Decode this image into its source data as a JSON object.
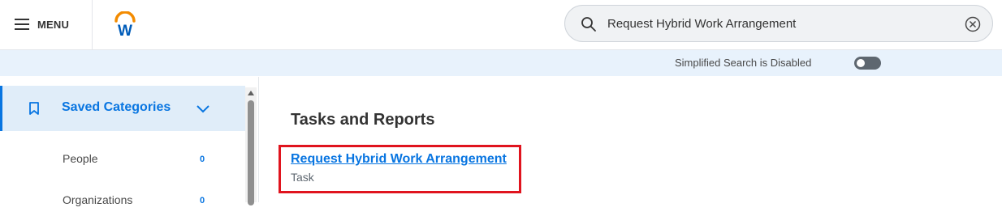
{
  "header": {
    "menu_label": "MENU",
    "logo_letter": "W",
    "search": {
      "value": "Request Hybrid Work Arrangement",
      "placeholder": "Search"
    }
  },
  "search_bar_notice": {
    "text": "Simplified Search is Disabled",
    "toggle_state": "off"
  },
  "sidebar": {
    "selected_category": "Saved Categories",
    "categories": [
      {
        "name": "People",
        "count": "0"
      },
      {
        "name": "Organizations",
        "count": "0"
      }
    ]
  },
  "main": {
    "section_title": "Tasks and Reports",
    "results": [
      {
        "title": "Request Hybrid Work Arrangement",
        "type": "Task"
      }
    ]
  },
  "colors": {
    "accent": "#0875e1",
    "highlight": "#e0141e",
    "band": "#e8f2fc",
    "logo_orange": "#f38b00"
  }
}
